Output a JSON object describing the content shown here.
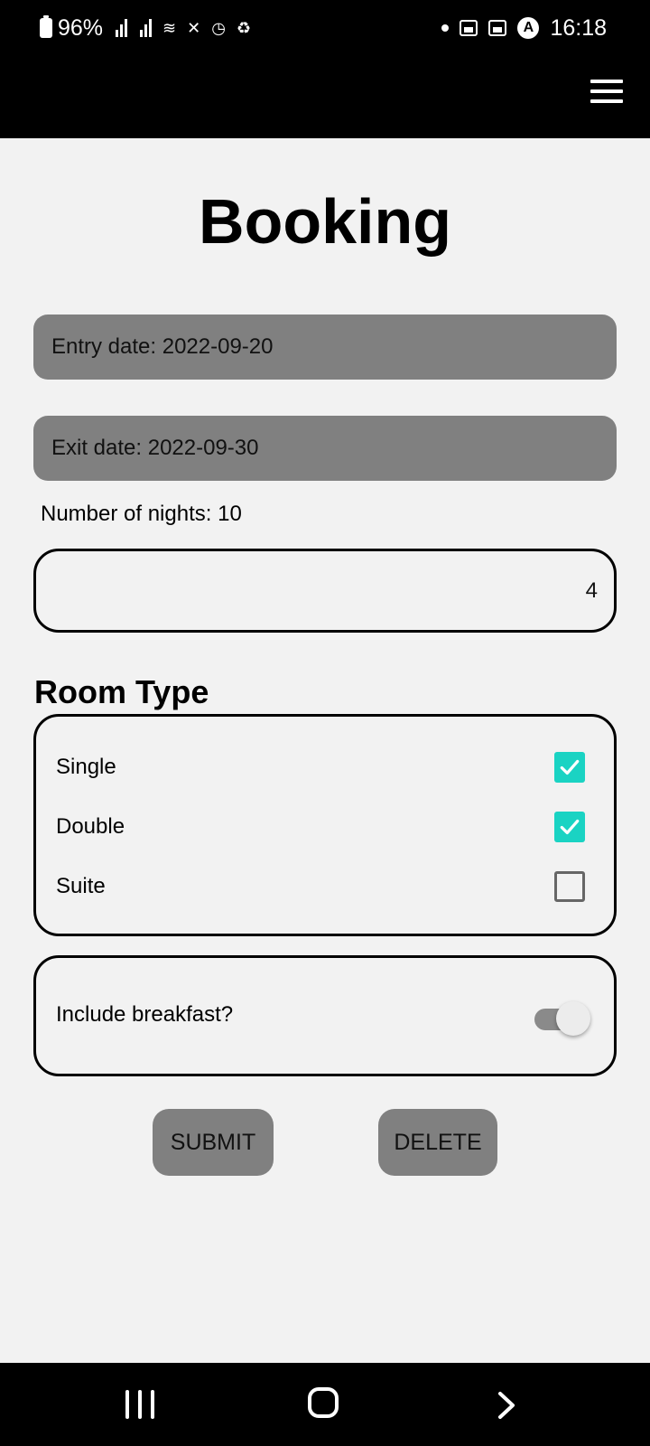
{
  "status_bar": {
    "battery": "96%",
    "time": "16:18"
  },
  "header": {
    "menu_icon": "hamburger-menu-icon"
  },
  "page": {
    "title": "Booking"
  },
  "form": {
    "entry_date": "Entry date: 2022-09-20",
    "exit_date": "Exit date: 2022-09-30",
    "nights": "Number of nights: 10",
    "number_value": "4",
    "room_type_title": "Room Type",
    "room_types": [
      {
        "label": "Single",
        "checked": true
      },
      {
        "label": "Double",
        "checked": true
      },
      {
        "label": "Suite",
        "checked": false
      }
    ],
    "breakfast_label": "Include breakfast?",
    "breakfast_on": false
  },
  "buttons": {
    "submit": "SUBMIT",
    "delete": "DELETE"
  },
  "colors": {
    "accent": "#1ad3c3",
    "field_bg": "#808080",
    "page_bg": "#f2f2f2"
  }
}
